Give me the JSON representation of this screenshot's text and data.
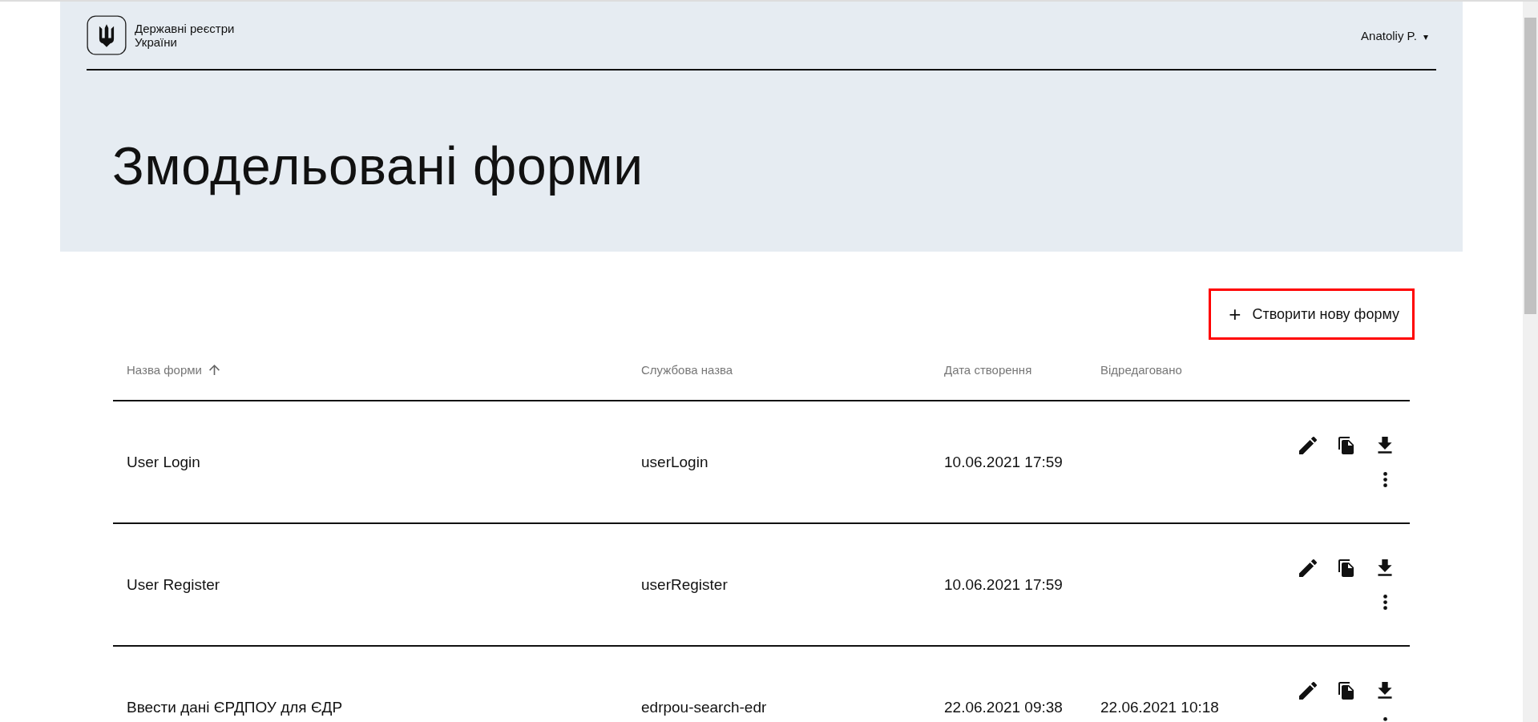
{
  "header": {
    "logo_text": "Державні реєстри України",
    "user": "Anatoliy P.",
    "user_menu_icon": "▾"
  },
  "page_title": "Змодельовані форми",
  "create_button": {
    "icon": "+",
    "label": "Створити нову форму",
    "highlighted": true
  },
  "table": {
    "columns": [
      {
        "label": "Назва форми",
        "sorted": true
      },
      {
        "label": "Службова назва",
        "sorted": false
      },
      {
        "label": "Дата створення",
        "sorted": false
      },
      {
        "label": "Відредаговано",
        "sorted": false
      }
    ],
    "rows": [
      {
        "title": "User Login",
        "name": "userLogin",
        "created": "10.06.2021 17:59"
      },
      {
        "title": "User Register",
        "name": "userRegister",
        "created": "10.06.2021 17:59"
      },
      {
        "title": "Ввести дані ЄРДПОУ для ЄДР",
        "name": "edrpou-search-edr",
        "created": "22.06.2021 09:38",
        "edited": "22.06.2021 10:18"
      }
    ]
  }
}
